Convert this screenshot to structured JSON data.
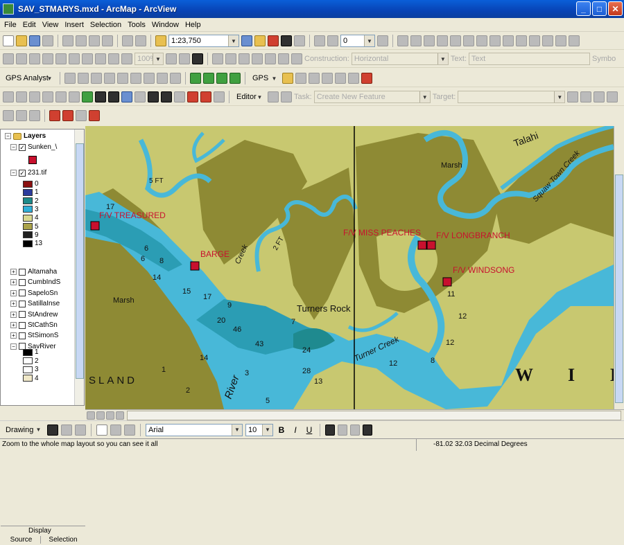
{
  "window": {
    "title": "SAV_STMARYS.mxd - ArcMap - ArcView",
    "min": "_",
    "max": "□",
    "close": "✕"
  },
  "menu": [
    "File",
    "Edit",
    "View",
    "Insert",
    "Selection",
    "Tools",
    "Window",
    "Help"
  ],
  "toolbar1": {
    "scale": "1:23,750",
    "layer_combo": "0"
  },
  "toolbar2": {
    "zoom": "100%",
    "construction_label": "Construction:",
    "construction_value": "Horizontal",
    "text_label": "Text:",
    "text_value": "Text",
    "symbo_label": "Symbo"
  },
  "toolbar3": {
    "gps_analyst": "GPS Analyst",
    "gps": "GPS"
  },
  "toolbar4": {
    "editor": "Editor",
    "task_label": "Task:",
    "task_value": "Create New Feature",
    "target_label": "Target:"
  },
  "toc": {
    "layers_title": "Layers",
    "sunken_layer": "Sunken_\\",
    "raster_layer": "231.tif",
    "raster_classes": [
      {
        "label": "0",
        "color": "#8b1010"
      },
      {
        "label": "1",
        "color": "#2c3b9c"
      },
      {
        "label": "2",
        "color": "#1d8a8a"
      },
      {
        "label": "3",
        "color": "#2fb0d8"
      },
      {
        "label": "4",
        "color": "#d8d890"
      },
      {
        "label": "5",
        "color": "#aaa24a"
      },
      {
        "label": "9",
        "color": "#202020"
      },
      {
        "label": "13",
        "color": "#000000"
      }
    ],
    "other_layers": [
      "Altamaha",
      "CumbIndS",
      "SapeloSn",
      "SatillaInse",
      "StAndrew",
      "StCathSn",
      "StSimonS",
      "SavRiver"
    ],
    "savriver_classes": [
      {
        "label": "1",
        "color": "#000000"
      },
      {
        "label": "2",
        "color": "#ffffff"
      },
      {
        "label": "3",
        "color": "#ffffff"
      },
      {
        "label": "4",
        "color": "#f0e8c8"
      }
    ],
    "tab_display": "Display",
    "tab_source": "Source",
    "tab_selection": "Selection"
  },
  "map": {
    "labels": {
      "treasured": "F/V TREASURED",
      "barge": "BARGE",
      "miss_peaches": "F/V MISS PEACHES",
      "longbranch": "F/V LONGBRANCH",
      "windsong": "F/V WINDSONG",
      "marsh_left": "Marsh",
      "marsh_right": "Marsh",
      "turners_rock": "Turners Rock",
      "turner_creek": "Turner Creek",
      "squaw": "Squaw Town Creek",
      "talahi": "Talahi",
      "island": "SLAND",
      "river": "River",
      "creek": "Creek",
      "wi": "W I I",
      "ft5": "5 FT",
      "ft2": "2 FT"
    },
    "soundings": [
      "17",
      "6",
      "8",
      "14",
      "15",
      "17",
      "9",
      "20",
      "46",
      "43",
      "24",
      "28",
      "13",
      "12",
      "8",
      "12",
      "12",
      "6",
      "7",
      "5",
      "3",
      "1",
      "14",
      "2",
      "11"
    ]
  },
  "drawing": {
    "label": "Drawing",
    "font": "Arial",
    "size": "10",
    "bold": "B",
    "italic": "I",
    "underline": "U"
  },
  "status": {
    "message": "Zoom to the whole map layout so you can see it all",
    "coords": "-81.02  32.03 Decimal Degrees"
  },
  "colors": {
    "water_deep": "#2b9db4",
    "water_shallow": "#48b8d8",
    "marsh": "#8e8a34",
    "land": "#c8c870",
    "wreck": "#c8102e"
  }
}
